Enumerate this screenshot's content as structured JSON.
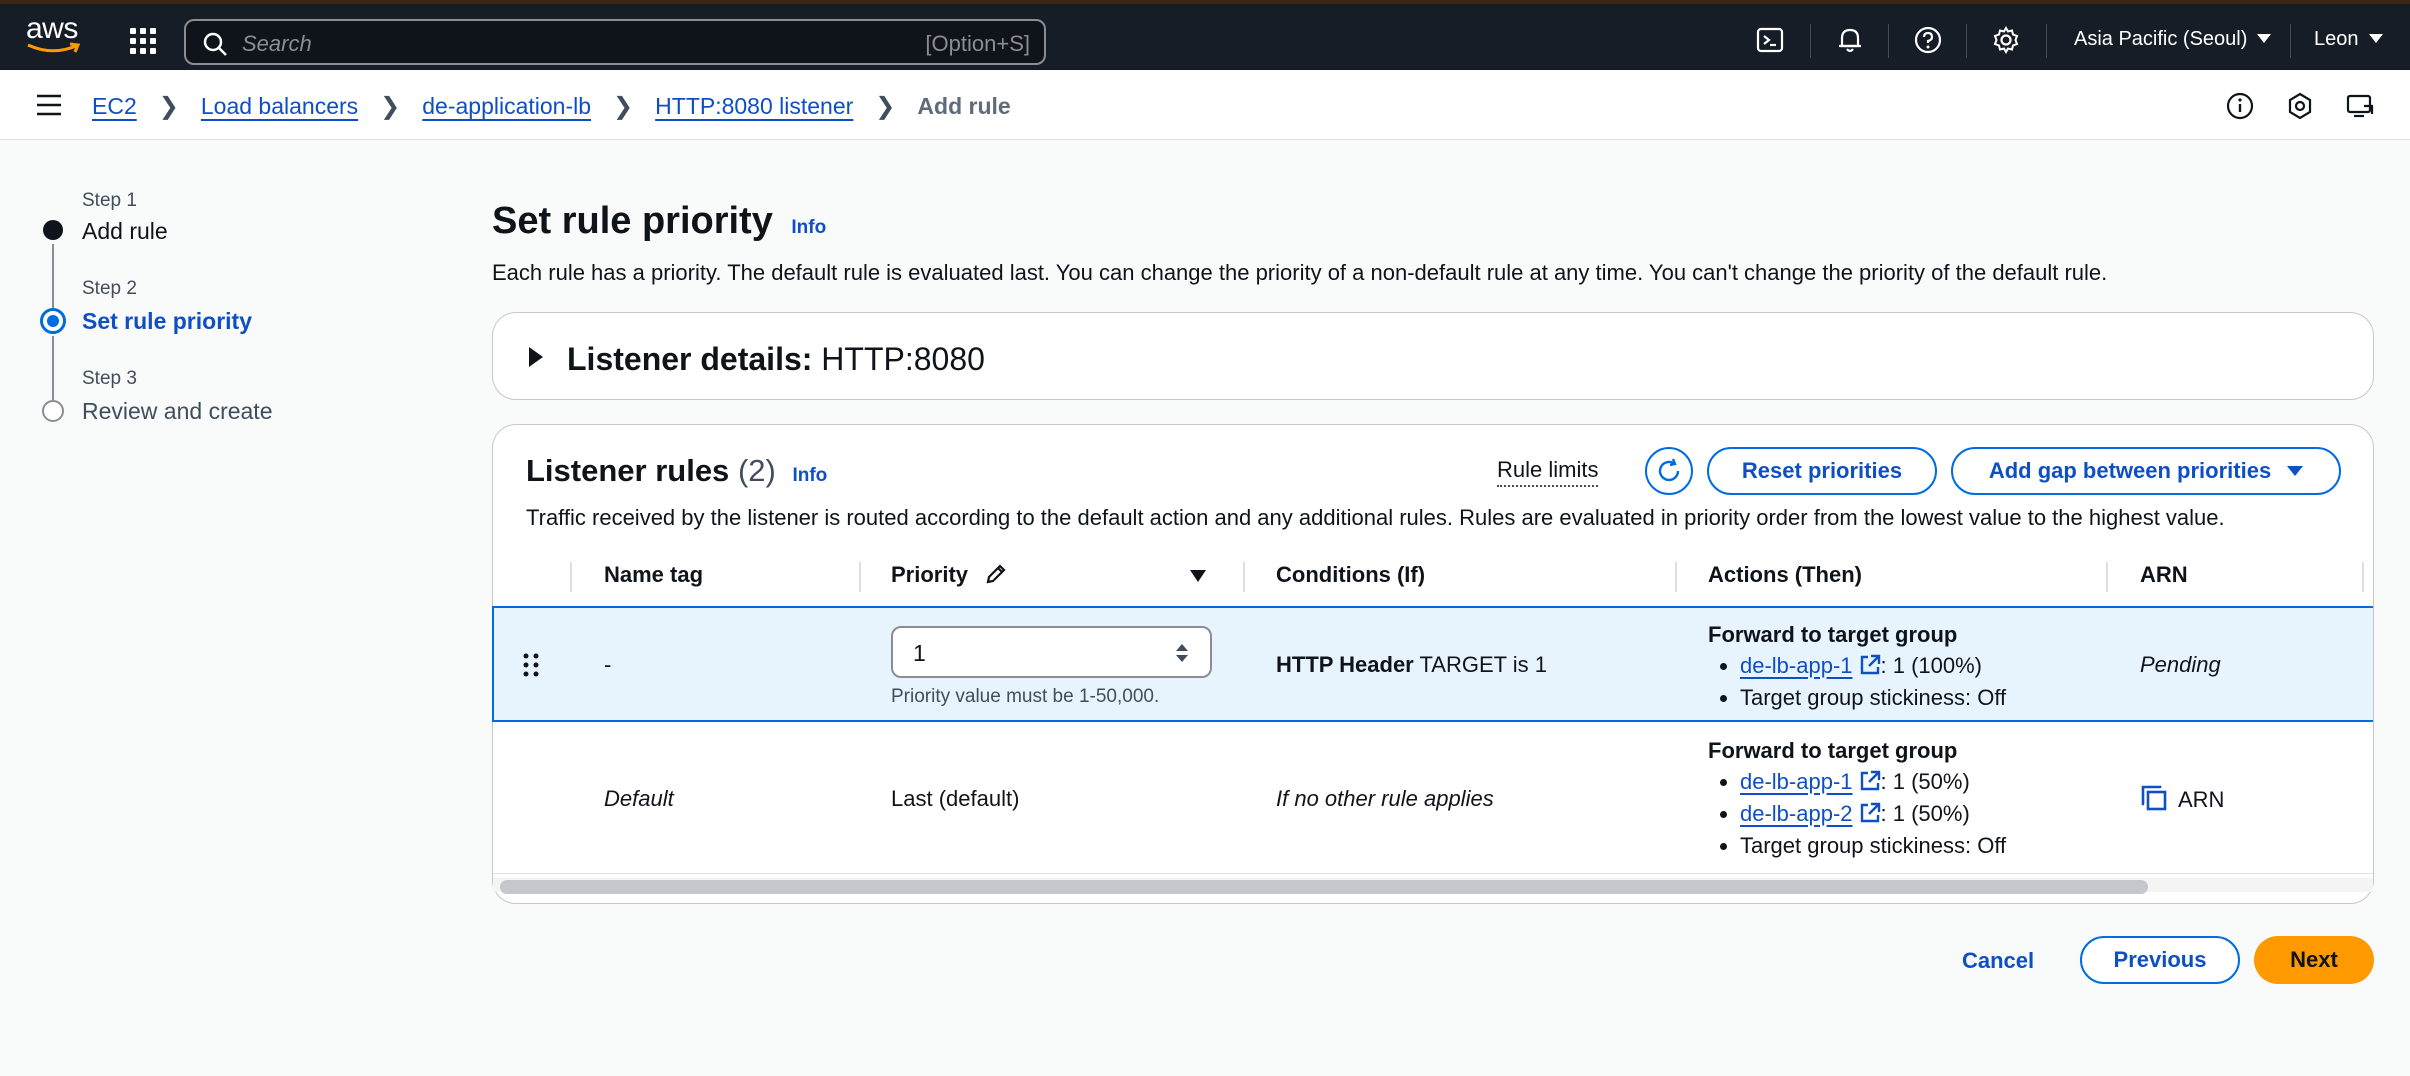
{
  "topbar": {
    "logo_text": "aws",
    "search_placeholder": "Search",
    "search_shortcut": "[Option+S]",
    "region": "Asia Pacific (Seoul)",
    "user": "Leon"
  },
  "breadcrumb": {
    "items": [
      "EC2",
      "Load balancers",
      "de-application-lb",
      "HTTP:8080 listener"
    ],
    "current": "Add rule"
  },
  "steps": [
    {
      "label": "Step 1",
      "title": "Add rule",
      "state": "complete"
    },
    {
      "label": "Step 2",
      "title": "Set rule priority",
      "state": "active"
    },
    {
      "label": "Step 3",
      "title": "Review and create",
      "state": "pending"
    }
  ],
  "page": {
    "title": "Set rule priority",
    "info": "Info",
    "description": "Each rule has a priority. The default rule is evaluated last. You can change the priority of a non-default rule at any time. You can't change the priority of the default rule."
  },
  "listener_details": {
    "label": "Listener details:",
    "value": "HTTP:8080"
  },
  "listener_rules": {
    "title": "Listener rules",
    "count": "(2)",
    "info": "Info",
    "rule_limits": "Rule limits",
    "reset_button": "Reset priorities",
    "gap_button": "Add gap between priorities",
    "description": "Traffic received by the listener is routed according to the default action and any additional rules. Rules are evaluated in priority order from the lowest value to the highest value.",
    "columns": [
      "Name tag",
      "Priority",
      "Conditions (If)",
      "Actions (Then)",
      "ARN"
    ],
    "rows": [
      {
        "name": "-",
        "priority_value": "1",
        "priority_hint": "Priority value must be 1-50,000.",
        "condition_bold": "HTTP Header",
        "condition_rest": " TARGET is 1",
        "action_title": "Forward to target group",
        "targets": [
          {
            "name": "de-lb-app-1",
            "weight": ": 1 (100%)"
          }
        ],
        "stickiness": "Target group stickiness: Off",
        "arn": "Pending"
      },
      {
        "name": "Default",
        "priority": "Last (default)",
        "condition": "If no other rule applies",
        "action_title": "Forward to target group",
        "targets": [
          {
            "name": "de-lb-app-1",
            "weight": ": 1 (50%)"
          },
          {
            "name": "de-lb-app-2",
            "weight": ": 1 (50%)"
          }
        ],
        "stickiness": "Target group stickiness: Off",
        "arn": "ARN"
      }
    ]
  },
  "footer": {
    "cancel": "Cancel",
    "previous": "Previous",
    "next": "Next"
  },
  "colors": {
    "link": "#0f4fc4",
    "primary": "#ff9900",
    "selected_row": "#e8f4fd",
    "topbar": "#161d26"
  }
}
